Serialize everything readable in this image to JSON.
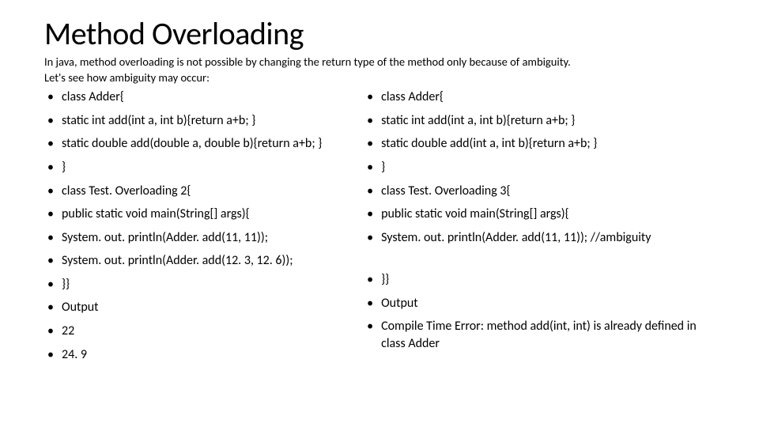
{
  "title": "Method Overloading",
  "intro_line1": "In java, method overloading is not possible by changing the return type of the method only because of ambiguity.",
  "intro_line2": "Let's see how ambiguity may occur:",
  "left": {
    "items": [
      "class Adder{",
      "static int add(int a, int b){return a+b; }",
      "static double add(double a, double b){return a+b; }",
      "}",
      "class Test. Overloading 2{",
      "public static void main(String[] args){",
      "System. out. println(Adder. add(11, 11));",
      "System. out. println(Adder. add(12. 3, 12. 6));",
      "}}",
      "Output",
      "22",
      "24. 9"
    ]
  },
  "right": {
    "group1": [
      "class Adder{",
      "static int add(int a, int b){return a+b; }",
      "static double add(int a, int b){return a+b; }",
      "}",
      "class Test. Overloading 3{",
      "public static void main(String[] args){",
      "System. out. println(Adder. add(11, 11)); //ambiguity"
    ],
    "group2": [
      "}}",
      "Output",
      "Compile Time Error: method add(int, int) is already defined in class Adder"
    ]
  }
}
